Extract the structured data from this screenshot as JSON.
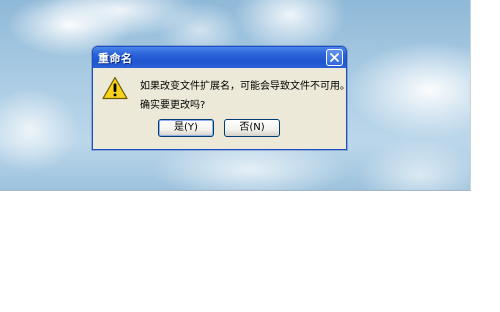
{
  "dialog": {
    "title": "重命名",
    "message_line1": "如果改变文件扩展名，可能会导致文件不可用。",
    "message_line2": "确实要更改吗?",
    "buttons": {
      "yes": "是(Y)",
      "no": "否(N)"
    },
    "icons": {
      "warning": "warning-icon",
      "close": "close-icon"
    }
  },
  "colors": {
    "titlebar": "#2a63d8",
    "dialog_bg": "#ece9d8",
    "button_border": "#003c74",
    "warning_fill": "#f7d21d"
  }
}
